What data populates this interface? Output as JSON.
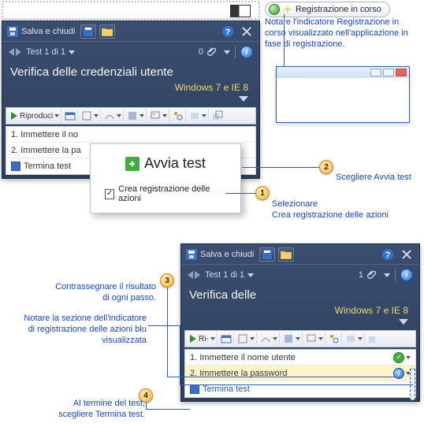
{
  "panel1": {
    "save_label": "Salva e chiudi",
    "nav_label": "Test 1 di 1",
    "step_count": "0",
    "heading": "Verifica delle credenziali utente",
    "subhead": "Windows 7 e IE 8",
    "play_label": "Riproduci",
    "steps": [
      "1. Immettere il no",
      "2. Immettere la pa",
      "Termina test"
    ]
  },
  "popup": {
    "start_label": "Avvia test",
    "create_rec_label": "Crea registrazione delle azioni"
  },
  "panel2": {
    "save_label": "Salva e chiudi",
    "nav_label": "Test 1 di 1",
    "step_count": "1",
    "heading": "Verifica delle",
    "subhead": "Windows 7 e IE 8",
    "play_label": "Ri-",
    "steps": [
      "1. Immettere il nome utente",
      "2. Immettere la password",
      "Termina test"
    ]
  },
  "recording_badge": "Registrazione in corso",
  "callouts": {
    "rec_note": "Notare l'indicatore Registrazione in corso visualizzato nell'applicazione in fase di registrazione.",
    "c2": "Scegliere Avvia test",
    "c1a": "Selezionare",
    "c1b": "Crea registrazione delle azioni",
    "c3a": "Contrassegnare il risultato",
    "c3b": "di ogni passo.",
    "c_note2a": "Notare la sezione dell'indicatore",
    "c_note2b": "di registrazione delle azioni blu",
    "c_note2c": "visualizzata",
    "c4a": "Al termine del test,",
    "c4b": "scegliere Termina test."
  },
  "nums": {
    "n1": "1",
    "n2": "2",
    "n3": "3",
    "n4": "4"
  }
}
